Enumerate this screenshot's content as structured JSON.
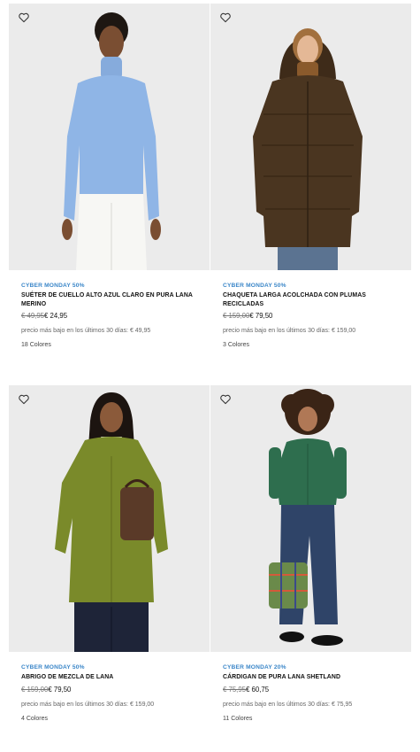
{
  "products": [
    {
      "promo": "CYBER MONDAY 50%",
      "title": "SUÉTER DE CUELLO ALTO AZUL CLARO EN PURA LANA MERINO",
      "old_price": "€ 49,95",
      "new_price": "€ 24,95",
      "lowest_price": "precio más bajo en los últimos 30 días: € 49,95",
      "colors": "18 Colores",
      "favorite_icon": "heart-outline-icon"
    },
    {
      "promo": "CYBER MONDAY 50%",
      "title": "CHAQUETA LARGA ACOLCHADA CON PLUMAS RECICLADAS",
      "old_price": "€ 159,00",
      "new_price": "€ 79,50",
      "lowest_price": "precio más bajo en los últimos 30 días: € 159,00",
      "colors": "3 Colores",
      "favorite_icon": "heart-outline-icon"
    },
    {
      "promo": "CYBER MONDAY 50%",
      "title": "ABRIGO DE MEZCLA DE LANA",
      "old_price": "€ 159,00",
      "new_price": "€ 79,50",
      "lowest_price": "precio más bajo en los últimos 30 días: € 159,00",
      "colors": "4 Colores",
      "favorite_icon": "heart-outline-icon"
    },
    {
      "promo": "CYBER MONDAY 20%",
      "title": "CÁRDIGAN DE PURA LANA SHETLAND",
      "old_price": "€ 75,95",
      "new_price": "€ 60,75",
      "lowest_price": "precio más bajo en los últimos 30 días: € 75,95",
      "colors": "11 Colores",
      "favorite_icon": "heart-outline-icon"
    }
  ],
  "colors": {
    "promo": "#3a86c8",
    "image_background": "#ebebeb",
    "sweater": "#8fb5e6",
    "jacket": "#4a3520",
    "coat": "#7a8a2a",
    "cardigan": "#2e6e4e"
  }
}
